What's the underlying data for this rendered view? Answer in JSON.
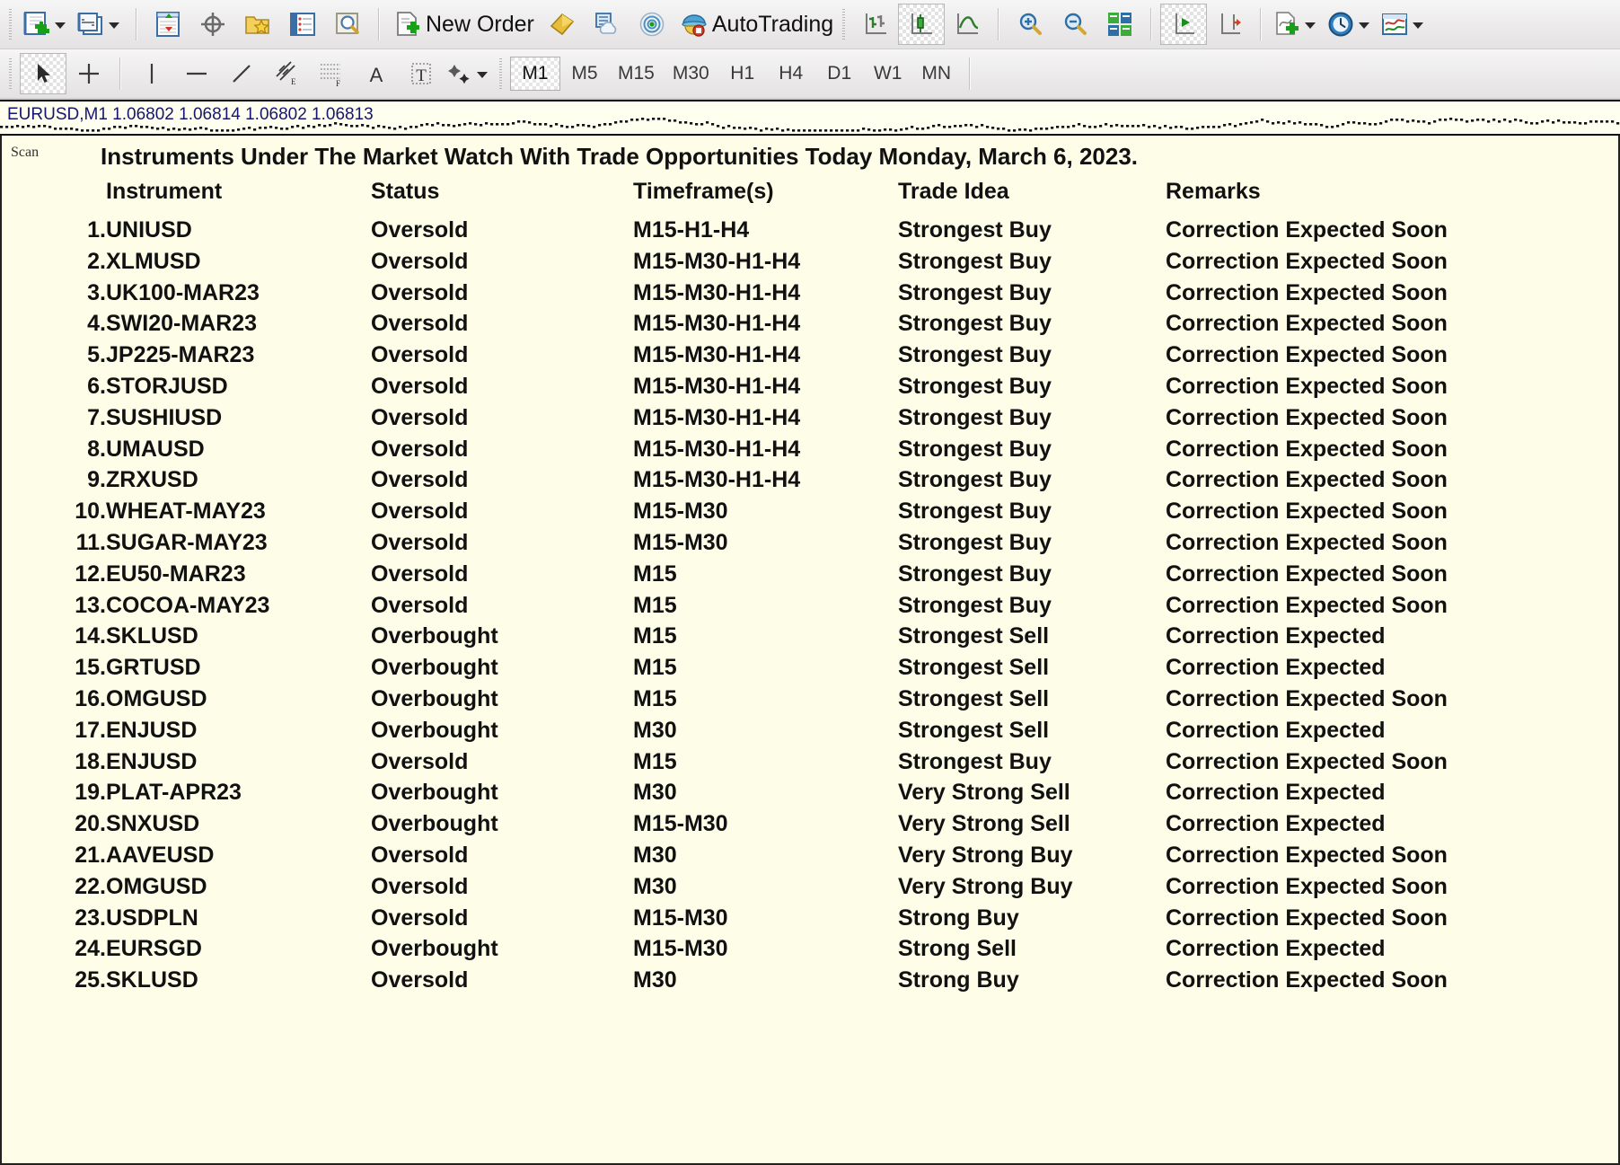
{
  "toolbar": {
    "main_row": [
      {
        "name": "new-chart-button",
        "icon": "new-chart-icon",
        "caret": true
      },
      {
        "name": "chart-profiles-button",
        "icon": "profiles-icon",
        "caret": true
      },
      {
        "name": "market-watch-button",
        "icon": "market-watch-icon",
        "caret": false
      },
      {
        "name": "data-window-button",
        "icon": "crosshair-target-icon",
        "caret": false
      },
      {
        "name": "navigator-button",
        "icon": "folder-star-icon",
        "caret": false
      },
      {
        "name": "terminal-button",
        "icon": "terminal-list-icon",
        "caret": false
      },
      {
        "name": "strategy-tester-button",
        "icon": "tester-magnifier-icon",
        "caret": false
      },
      {
        "name": "new-order-button",
        "icon": "new-order-icon",
        "label": "New Order",
        "caret": false
      },
      {
        "name": "metaeditor-button",
        "icon": "metaeditor-gold-icon",
        "caret": false
      },
      {
        "name": "mql5-community-button",
        "icon": "community-cloud-icon",
        "caret": false
      },
      {
        "name": "signals-button",
        "icon": "signals-radar-icon",
        "caret": false
      },
      {
        "name": "autotrading-button",
        "icon": "autotrading-icon",
        "label": "AutoTrading",
        "caret": false
      },
      {
        "name": "bar-chart-button",
        "icon": "bar-chart-icon",
        "caret": false
      },
      {
        "name": "candlestick-chart-button",
        "icon": "candlestick-chart-icon",
        "caret": false,
        "active": true
      },
      {
        "name": "line-chart-button",
        "icon": "line-chart-icon",
        "caret": false
      },
      {
        "name": "zoom-in-button",
        "icon": "zoom-in-icon",
        "caret": false
      },
      {
        "name": "zoom-out-button",
        "icon": "zoom-out-icon",
        "caret": false
      },
      {
        "name": "tile-windows-button",
        "icon": "tile-windows-icon",
        "caret": false
      },
      {
        "name": "auto-scroll-button",
        "icon": "auto-scroll-icon",
        "caret": false,
        "active": true
      },
      {
        "name": "chart-shift-button",
        "icon": "chart-shift-icon",
        "caret": false
      },
      {
        "name": "indicators-button",
        "icon": "indicators-icon",
        "caret": true
      },
      {
        "name": "periods-button",
        "icon": "clock-periods-icon",
        "caret": true
      },
      {
        "name": "templates-button",
        "icon": "templates-icon",
        "caret": true
      }
    ],
    "tools_row": [
      {
        "name": "cursor-tool",
        "icon": "arrow-cursor-icon",
        "active": true
      },
      {
        "name": "crosshair-tool",
        "icon": "crosshair-icon",
        "active": false
      },
      {
        "name": "vertical-line-tool",
        "icon": "vertical-line-icon",
        "active": false
      },
      {
        "name": "horizontal-line-tool",
        "icon": "horizontal-line-icon",
        "active": false
      },
      {
        "name": "trendline-tool",
        "icon": "trendline-icon",
        "active": false
      },
      {
        "name": "equidistant-channel-tool",
        "icon": "equidistant-channel-icon",
        "active": false
      },
      {
        "name": "fibonacci-retracement-tool",
        "icon": "fibonacci-icon",
        "active": false
      },
      {
        "name": "text-tool",
        "icon": "text-a-icon",
        "active": false
      },
      {
        "name": "text-label-tool",
        "icon": "text-label-icon",
        "active": false
      },
      {
        "name": "shapes-tool",
        "icon": "shapes-icon",
        "active": false,
        "caret": true
      }
    ],
    "timeframes": [
      {
        "label": "M1",
        "active": true
      },
      {
        "label": "M5",
        "active": false
      },
      {
        "label": "M15",
        "active": false
      },
      {
        "label": "M30",
        "active": false
      },
      {
        "label": "H1",
        "active": false
      },
      {
        "label": "H4",
        "active": false
      },
      {
        "label": "D1",
        "active": false
      },
      {
        "label": "W1",
        "active": false
      },
      {
        "label": "MN",
        "active": false
      }
    ]
  },
  "chart": {
    "quote_line": "EURUSD,M1  1.06802 1.06814 1.06802 1.06813",
    "symbol": "EURUSD",
    "period": "M1",
    "open": "1.06802",
    "high": "1.06814",
    "low": "1.06802",
    "close": "1.06813"
  },
  "scan": {
    "panel_label": "Scan",
    "title": "Instruments Under The Market Watch With Trade Opportunities Today Monday, March 6, 2023.",
    "columns": [
      "Instrument",
      "Status",
      "Timeframe(s)",
      "Trade Idea",
      "Remarks"
    ],
    "colors": {
      "bullish": "#007a00",
      "bearish": "#ff0000",
      "neutral": "#111111",
      "panel_background": "#fdfde8"
    },
    "rows": [
      {
        "n": "1.",
        "instrument": "UNIUSD",
        "instrument_color": "red",
        "status": "Oversold",
        "status_color": "red",
        "timeframes": "M15-H1-H4",
        "idea": "Strongest Buy",
        "idea_color": "green",
        "remarks": "Correction Expected Soon"
      },
      {
        "n": "2.",
        "instrument": "XLMUSD",
        "instrument_color": "red",
        "status": "Oversold",
        "status_color": "red",
        "timeframes": "M15-M30-H1-H4",
        "idea": "Strongest Buy",
        "idea_color": "green",
        "remarks": "Correction Expected Soon"
      },
      {
        "n": "3.",
        "instrument": "UK100-MAR23",
        "instrument_color": "red",
        "status": "Oversold",
        "status_color": "red",
        "timeframes": "M15-M30-H1-H4",
        "idea": "Strongest Buy",
        "idea_color": "green",
        "remarks": "Correction Expected Soon"
      },
      {
        "n": "4.",
        "instrument": "SWI20-MAR23",
        "instrument_color": "red",
        "status": "Oversold",
        "status_color": "red",
        "timeframes": "M15-M30-H1-H4",
        "idea": "Strongest Buy",
        "idea_color": "green",
        "remarks": "Correction Expected Soon"
      },
      {
        "n": "5.",
        "instrument": "JP225-MAR23",
        "instrument_color": "red",
        "status": "Oversold",
        "status_color": "red",
        "timeframes": "M15-M30-H1-H4",
        "idea": "Strongest Buy",
        "idea_color": "green",
        "remarks": "Correction Expected Soon"
      },
      {
        "n": "6.",
        "instrument": "STORJUSD",
        "instrument_color": "red",
        "status": "Oversold",
        "status_color": "red",
        "timeframes": "M15-M30-H1-H4",
        "idea": "Strongest Buy",
        "idea_color": "green",
        "remarks": "Correction Expected Soon"
      },
      {
        "n": "7.",
        "instrument": "SUSHIUSD",
        "instrument_color": "red",
        "status": "Oversold",
        "status_color": "red",
        "timeframes": "M15-M30-H1-H4",
        "idea": "Strongest Buy",
        "idea_color": "green",
        "remarks": "Correction Expected Soon"
      },
      {
        "n": "8.",
        "instrument": "UMAUSD",
        "instrument_color": "red",
        "status": "Oversold",
        "status_color": "red",
        "timeframes": "M15-M30-H1-H4",
        "idea": "Strongest Buy",
        "idea_color": "green",
        "remarks": "Correction Expected Soon"
      },
      {
        "n": "9.",
        "instrument": "ZRXUSD",
        "instrument_color": "red",
        "status": "Oversold",
        "status_color": "red",
        "timeframes": "M15-M30-H1-H4",
        "idea": "Strongest Buy",
        "idea_color": "green",
        "remarks": "Correction Expected Soon"
      },
      {
        "n": "10.",
        "instrument": "WHEAT-MAY23",
        "instrument_color": "red",
        "status": "Oversold",
        "status_color": "red",
        "timeframes": "M15-M30",
        "idea": "Strongest Buy",
        "idea_color": "green",
        "remarks": "Correction Expected Soon"
      },
      {
        "n": "11.",
        "instrument": "SUGAR-MAY23",
        "instrument_color": "red",
        "status": "Oversold",
        "status_color": "red",
        "timeframes": "M15-M30",
        "idea": "Strongest Buy",
        "idea_color": "green",
        "remarks": "Correction Expected Soon"
      },
      {
        "n": "12.",
        "instrument": "EU50-MAR23",
        "instrument_color": "red",
        "status": "Oversold",
        "status_color": "red",
        "timeframes": "M15",
        "idea": "Strongest Buy",
        "idea_color": "green",
        "remarks": "Correction Expected Soon"
      },
      {
        "n": "13.",
        "instrument": "COCOA-MAY23",
        "instrument_color": "red",
        "status": "Oversold",
        "status_color": "red",
        "timeframes": "M15",
        "idea": "Strongest Buy",
        "idea_color": "green",
        "remarks": "Correction Expected Soon"
      },
      {
        "n": "14.",
        "instrument": "SKLUSD",
        "instrument_color": "green",
        "status": "Overbought",
        "status_color": "green",
        "timeframes": "M15",
        "idea": "Strongest Sell",
        "idea_color": "red",
        "remarks": "Correction Expected"
      },
      {
        "n": "15.",
        "instrument": "GRTUSD",
        "instrument_color": "green",
        "status": "Overbought",
        "status_color": "green",
        "timeframes": "M15",
        "idea": "Strongest Sell",
        "idea_color": "red",
        "remarks": "Correction Expected"
      },
      {
        "n": "16.",
        "instrument": "OMGUSD",
        "instrument_color": "green",
        "status": "Overbought",
        "status_color": "green",
        "timeframes": "M15",
        "idea": "Strongest Sell",
        "idea_color": "red",
        "remarks": "Correction Expected Soon"
      },
      {
        "n": "17.",
        "instrument": "ENJUSD",
        "instrument_color": "green",
        "status": "Overbought",
        "status_color": "green",
        "timeframes": "M30",
        "idea": "Strongest Sell",
        "idea_color": "red",
        "remarks": "Correction Expected"
      },
      {
        "n": "18.",
        "instrument": "ENJUSD",
        "instrument_color": "red",
        "status": "Oversold",
        "status_color": "red",
        "timeframes": "M15",
        "idea": "Strongest Buy",
        "idea_color": "green",
        "remarks": "Correction Expected Soon"
      },
      {
        "n": "19.",
        "instrument": "PLAT-APR23",
        "instrument_color": "green",
        "status": "Overbought",
        "status_color": "green",
        "timeframes": "M30",
        "idea": "Very Strong Sell",
        "idea_color": "red",
        "remarks": "Correction Expected"
      },
      {
        "n": "20.",
        "instrument": "SNXUSD",
        "instrument_color": "green",
        "status": "Overbought",
        "status_color": "green",
        "timeframes": "M15-M30",
        "idea": "Very Strong Sell",
        "idea_color": "red",
        "remarks": "Correction Expected"
      },
      {
        "n": "21.",
        "instrument": "AAVEUSD",
        "instrument_color": "red",
        "status": "Oversold",
        "status_color": "red",
        "timeframes": "M30",
        "idea": "Very Strong Buy",
        "idea_color": "green",
        "remarks": "Correction Expected Soon"
      },
      {
        "n": "22.",
        "instrument": "OMGUSD",
        "instrument_color": "red",
        "status": "Oversold",
        "status_color": "red",
        "timeframes": "M30",
        "idea": "Very Strong Buy",
        "idea_color": "green",
        "remarks": "Correction Expected Soon"
      },
      {
        "n": "23.",
        "instrument": "USDPLN",
        "instrument_color": "red",
        "status": "Oversold",
        "status_color": "red",
        "timeframes": "M15-M30",
        "idea": "Strong Buy",
        "idea_color": "green",
        "remarks": "Correction Expected Soon"
      },
      {
        "n": "24.",
        "instrument": "EURSGD",
        "instrument_color": "green",
        "status": "Overbought",
        "status_color": "green",
        "timeframes": "M15-M30",
        "idea": "Strong Sell",
        "idea_color": "red",
        "remarks": "Correction Expected"
      },
      {
        "n": "25.",
        "instrument": "SKLUSD",
        "instrument_color": "red",
        "status": "Oversold",
        "status_color": "red",
        "timeframes": "M30",
        "idea": "Strong Buy",
        "idea_color": "green",
        "remarks": "Correction Expected Soon"
      }
    ]
  }
}
